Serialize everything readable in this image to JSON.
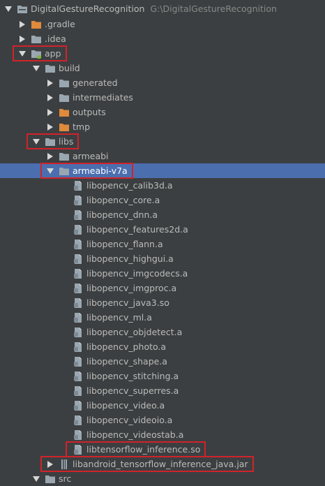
{
  "project": {
    "name": "DigitalGestureRecognition",
    "path": "G:\\DigitalGestureRecognition"
  },
  "colors": {
    "background": "#3c3f41",
    "selection": "#4b6eaf",
    "folder_gray": "#9aa7b0",
    "folder_orange": "#e08a3c",
    "highlight_box": "#d0232a"
  },
  "tree": [
    {
      "label": "DigitalGestureRecognition",
      "hint": "G:\\DigitalGestureRecognition",
      "depth": 0,
      "expanded": true,
      "icon": "project-folder-icon"
    },
    {
      "label": ".gradle",
      "depth": 1,
      "expanded": false,
      "icon": "folder-orange-icon"
    },
    {
      "label": ".idea",
      "depth": 1,
      "expanded": false,
      "icon": "folder-icon"
    },
    {
      "label": "app",
      "depth": 1,
      "expanded": true,
      "icon": "module-folder-icon",
      "highlighted": true
    },
    {
      "label": "build",
      "depth": 2,
      "expanded": true,
      "icon": "folder-icon"
    },
    {
      "label": "generated",
      "depth": 3,
      "expanded": false,
      "icon": "folder-icon"
    },
    {
      "label": "intermediates",
      "depth": 3,
      "expanded": false,
      "icon": "folder-icon"
    },
    {
      "label": "outputs",
      "depth": 3,
      "expanded": false,
      "icon": "folder-orange-icon"
    },
    {
      "label": "tmp",
      "depth": 3,
      "expanded": false,
      "icon": "folder-orange-icon"
    },
    {
      "label": "libs",
      "depth": 2,
      "expanded": true,
      "icon": "folder-icon",
      "highlighted": true
    },
    {
      "label": "armeabi",
      "depth": 3,
      "expanded": false,
      "icon": "folder-icon"
    },
    {
      "label": "armeabi-v7a",
      "depth": 3,
      "expanded": true,
      "icon": "folder-icon",
      "selected": true,
      "highlighted": true
    },
    {
      "label": "libopencv_calib3d.a",
      "depth": 4,
      "icon": "file-icon"
    },
    {
      "label": "libopencv_core.a",
      "depth": 4,
      "icon": "file-icon"
    },
    {
      "label": "libopencv_dnn.a",
      "depth": 4,
      "icon": "file-icon"
    },
    {
      "label": "libopencv_features2d.a",
      "depth": 4,
      "icon": "file-icon"
    },
    {
      "label": "libopencv_flann.a",
      "depth": 4,
      "icon": "file-icon"
    },
    {
      "label": "libopencv_highgui.a",
      "depth": 4,
      "icon": "file-icon"
    },
    {
      "label": "libopencv_imgcodecs.a",
      "depth": 4,
      "icon": "file-icon"
    },
    {
      "label": "libopencv_imgproc.a",
      "depth": 4,
      "icon": "file-icon"
    },
    {
      "label": "libopencv_java3.so",
      "depth": 4,
      "icon": "file-icon"
    },
    {
      "label": "libopencv_ml.a",
      "depth": 4,
      "icon": "file-icon"
    },
    {
      "label": "libopencv_objdetect.a",
      "depth": 4,
      "icon": "file-icon"
    },
    {
      "label": "libopencv_photo.a",
      "depth": 4,
      "icon": "file-icon"
    },
    {
      "label": "libopencv_shape.a",
      "depth": 4,
      "icon": "file-icon"
    },
    {
      "label": "libopencv_stitching.a",
      "depth": 4,
      "icon": "file-icon"
    },
    {
      "label": "libopencv_superres.a",
      "depth": 4,
      "icon": "file-icon"
    },
    {
      "label": "libopencv_video.a",
      "depth": 4,
      "icon": "file-icon"
    },
    {
      "label": "libopencv_videoio.a",
      "depth": 4,
      "icon": "file-icon"
    },
    {
      "label": "libopencv_videostab.a",
      "depth": 4,
      "icon": "file-icon"
    },
    {
      "label": "libtensorflow_inference.so",
      "depth": 4,
      "icon": "file-icon",
      "highlighted": true
    },
    {
      "label": "libandroid_tensorflow_inference_java.jar",
      "depth": 3,
      "expanded": false,
      "icon": "jar-icon",
      "highlighted": true
    },
    {
      "label": "src",
      "depth": 2,
      "expanded": true,
      "icon": "folder-icon"
    }
  ]
}
